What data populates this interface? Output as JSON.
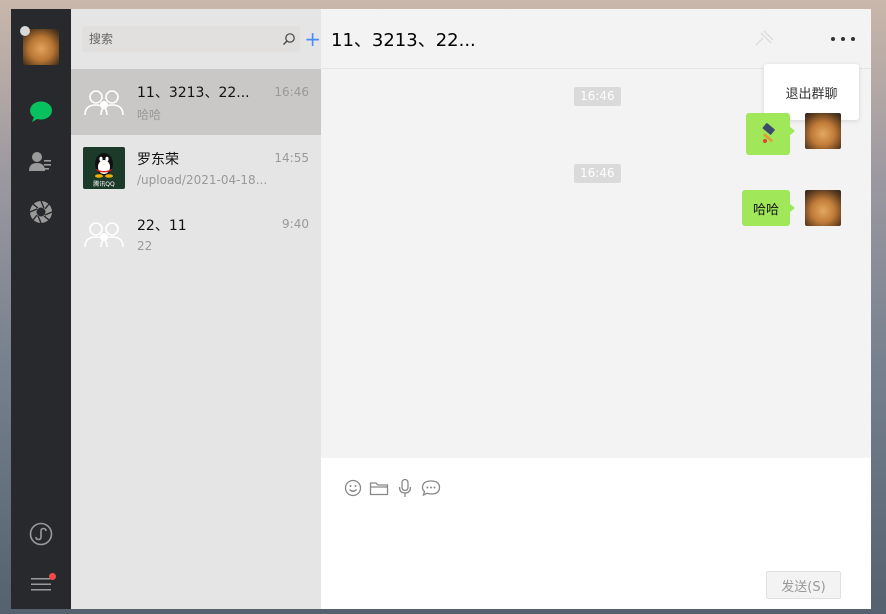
{
  "search": {
    "placeholder": "搜索"
  },
  "sessions": [
    {
      "name": "11、3213、22...",
      "last": "哈哈",
      "time": "16:46",
      "active": true
    },
    {
      "name": "罗东荣",
      "last": "/upload/2021-04-18...",
      "time": "14:55",
      "avatar_text": "腾讯QQ"
    },
    {
      "name": "22、11",
      "last": "22",
      "time": "9:40"
    }
  ],
  "chat": {
    "title": "11、3213、22...",
    "popup_label": "退出群聊",
    "time_tags": [
      "16:46",
      "16:46"
    ],
    "messages": [
      {
        "type": "image-sticker"
      },
      {
        "type": "text",
        "text": "哈哈"
      }
    ]
  },
  "composer": {
    "send_label": "发送(S)"
  },
  "colors": {
    "nav_bg": "#28292c",
    "accent_green": "#07c160",
    "bubble_green": "#a0e75a",
    "plus_blue": "#4a8cf7",
    "badge_red": "#f24b4b"
  },
  "icons": [
    "chat-icon",
    "contacts-icon",
    "moments-icon",
    "miniprogram-icon",
    "menu-icon",
    "search-icon",
    "emoji-icon",
    "folder-icon",
    "mic-icon",
    "chat-bubble-icon"
  ]
}
